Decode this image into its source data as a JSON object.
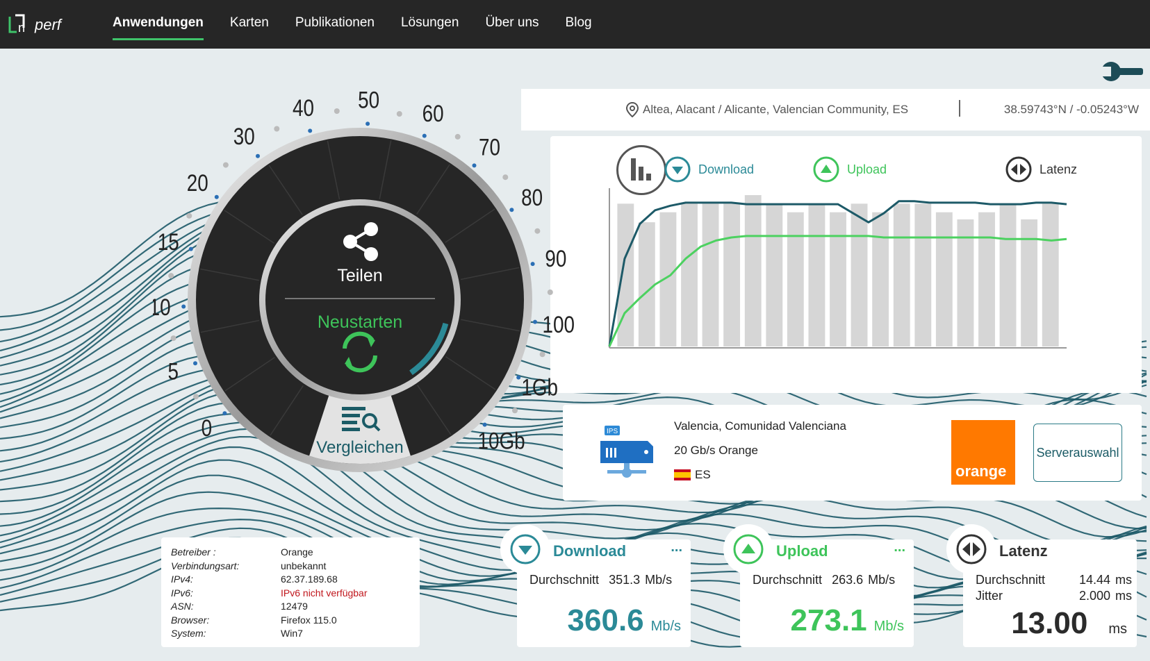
{
  "nav": {
    "logo_alt": "nperf",
    "items": [
      {
        "label": "Anwendungen",
        "active": true
      },
      {
        "label": "Karten"
      },
      {
        "label": "Publikationen"
      },
      {
        "label": "Lösungen"
      },
      {
        "label": "Über uns"
      },
      {
        "label": "Blog"
      }
    ]
  },
  "location": {
    "place": "Altea, Alacant / Alicante, Valencian Community, ES",
    "coords": "38.59743°N / -0.05243°W"
  },
  "legend": {
    "download": "Download",
    "upload": "Upload",
    "latency": "Latenz"
  },
  "chart_data": {
    "type": "bar",
    "bars": [
      1.0,
      0.87,
      0.94,
      1.0,
      1.0,
      1.0,
      1.06,
      1.0,
      0.94,
      1.0,
      0.94,
      1.0,
      0.94,
      1.0,
      1.0,
      0.94,
      0.89,
      0.94,
      1.0,
      0.89,
      1.0
    ],
    "series": [
      {
        "key": "download",
        "color": "#1d5a68",
        "values": [
          0,
          58,
          81,
          90,
          93,
          95,
          95,
          95,
          95,
          94,
          94,
          94,
          94,
          94,
          94,
          94,
          88,
          82,
          88,
          96,
          96,
          95,
          95,
          95,
          95,
          94,
          94,
          94,
          95,
          95,
          94
        ]
      },
      {
        "key": "upload",
        "color": "#4cd160",
        "values": [
          0,
          22,
          32,
          41,
          47,
          58,
          66,
          70,
          72,
          73,
          73,
          73,
          73,
          73,
          73,
          73,
          73,
          73,
          72,
          72,
          72,
          72,
          72,
          72,
          72,
          72,
          71,
          71,
          71,
          70,
          71
        ]
      }
    ]
  },
  "gauge": {
    "ticks": [
      "0",
      "5",
      "10",
      "15",
      "20",
      "30",
      "40",
      "50",
      "60",
      "70",
      "80",
      "90",
      "100",
      "1Gb",
      "10Gb"
    ],
    "share_label": "Teilen",
    "restart_label": "Neustarten",
    "compare_label": "Vergleichen",
    "progress": 0.18
  },
  "server": {
    "city": "Valencia, Comunidad Valenciana",
    "provider": "20 Gb/s Orange",
    "country": "ES",
    "ips_label": "IPS",
    "logo_text": "orange",
    "select_label": "Serverauswahl"
  },
  "info": [
    {
      "k": "Betreiber :",
      "v": "Orange"
    },
    {
      "k": "Verbindungsart:",
      "v": "unbekannt"
    },
    {
      "k": "IPv4:",
      "v": "62.37.189.68"
    },
    {
      "k": "IPv6:",
      "v": "IPv6 nicht verfügbar",
      "red": true
    },
    {
      "k": "ASN:",
      "v": "12479"
    },
    {
      "k": "Browser:",
      "v": "Firefox 115.0"
    },
    {
      "k": "System:",
      "v": "Win7"
    }
  ],
  "results": {
    "download": {
      "title": "Download",
      "dots": "...",
      "avg_label": "Durchschnitt",
      "avg": "351.3 Mb/s",
      "value": "360.6",
      "unit": "Mb/s",
      "color": "#2b7d8a"
    },
    "upload": {
      "title": "Upload",
      "dots": "...",
      "avg_label": "Durchschnitt",
      "avg": "263.6 Mb/s",
      "value": "273.1",
      "unit": "Mb/s",
      "color": "#3ec45a"
    },
    "latency": {
      "title": "Latenz",
      "avg_label": "Durchschnitt",
      "avg": "14.44 ms",
      "jitter_label": "Jitter",
      "jitter": "2.000 ms",
      "value": "13.00",
      "unit": "ms",
      "color": "#2b2b2b"
    }
  }
}
